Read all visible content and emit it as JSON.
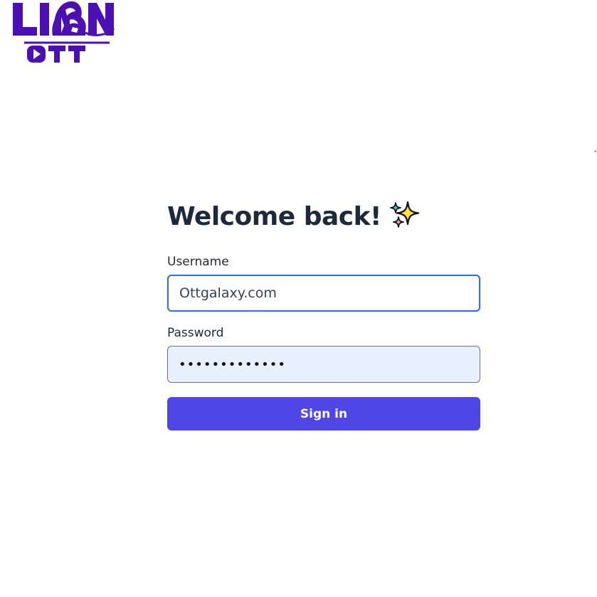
{
  "brand": {
    "logo_text_top": "LION",
    "logo_text_bottom": "OTT",
    "logo_color": "#4c0fb5"
  },
  "edge_mark": "˅",
  "login": {
    "heading": "Welcome back!",
    "heading_emoji": "sparkles-icon",
    "username": {
      "label": "Username",
      "value": "Ottgalaxy.com"
    },
    "password": {
      "label": "Password",
      "value": "•••••••••••••"
    },
    "submit_label": "Sign in"
  },
  "colors": {
    "heading": "#1e293b",
    "button": "#4f46e5",
    "focus_border": "#3b6fe0",
    "autofill_bg": "#e8f0fe"
  }
}
